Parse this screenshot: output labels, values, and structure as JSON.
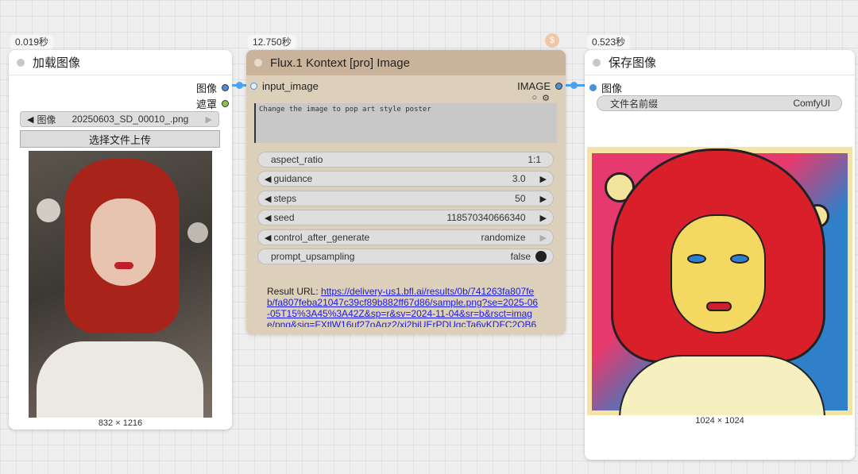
{
  "load_node": {
    "timing": "0.019秒",
    "title": "加载图像",
    "outputs": [
      "图像",
      "遮罩"
    ],
    "image_widget_label": "图像",
    "image_widget_value": "20250603_SD_00010_.png",
    "upload_button": "选择文件上传",
    "image_size": "832 × 1216"
  },
  "flux_node": {
    "timing": "12.750秒",
    "title": "Flux.1 Kontext [pro] Image",
    "input_label": "input_image",
    "output_label": "IMAGE",
    "prompt_text": "Change the image to pop art style poster",
    "widgets": [
      {
        "label": "aspect_ratio",
        "value": "1:1"
      },
      {
        "label": "guidance",
        "value": "3.0"
      },
      {
        "label": "steps",
        "value": "50"
      },
      {
        "label": "seed",
        "value": "118570340666340"
      },
      {
        "label": "control_after_generate",
        "value": "randomize"
      },
      {
        "label": "prompt_upsampling",
        "value": "false"
      }
    ],
    "result_label": "Result URL:",
    "result_url_lines": [
      "https://delivery-us1.bfl.ai/results/0b/741263fa807fe",
      "b/fa807feba21047c39cf89b882ff67d86/sample.png?se=2025-06",
      "-05T15%3A45%3A42Z&sp=r&sv=2024-11-04&sr=b&rsct=imag",
      "e/png&sig=FXtlW16uf27oAgz2/xi2biUErPDUgcTa6vKDFC2OB6"
    ]
  },
  "save_node": {
    "timing": "0.523秒",
    "title": "保存图像",
    "input_label": "图像",
    "prefix_label": "文件名前缀",
    "prefix_value": "ComfyUI",
    "image_size": "1024 × 1024"
  },
  "colors": {
    "flux_header": "#c9b49b",
    "flux_body": "#ddd0bb",
    "link": "#4aa3f0"
  }
}
